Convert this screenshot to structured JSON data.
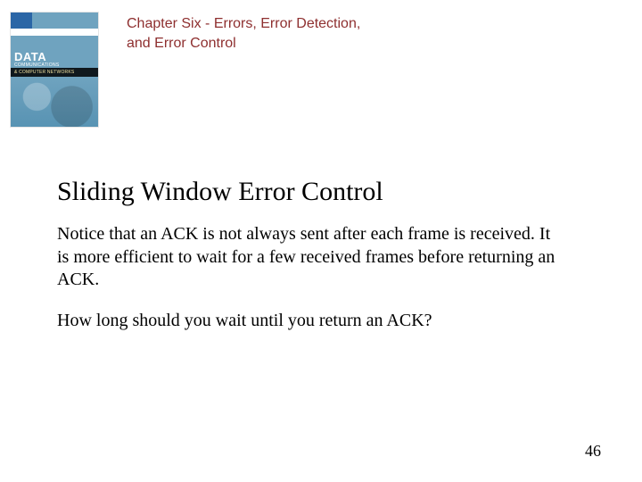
{
  "cover": {
    "word1": "DATA",
    "sub": "COMMUNICATIONS",
    "band": "& COMPUTER NETWORKS"
  },
  "header": {
    "chapter": "Chapter Six - Errors, Error Detection, and Error Control"
  },
  "slide": {
    "title": "Sliding Window Error Control",
    "para1": "Notice that an ACK is not always sent after each frame is received.  It is more efficient to wait for a few received frames before returning an ACK.",
    "para2": "How long should you wait until you return an ACK?"
  },
  "page_number": "46"
}
